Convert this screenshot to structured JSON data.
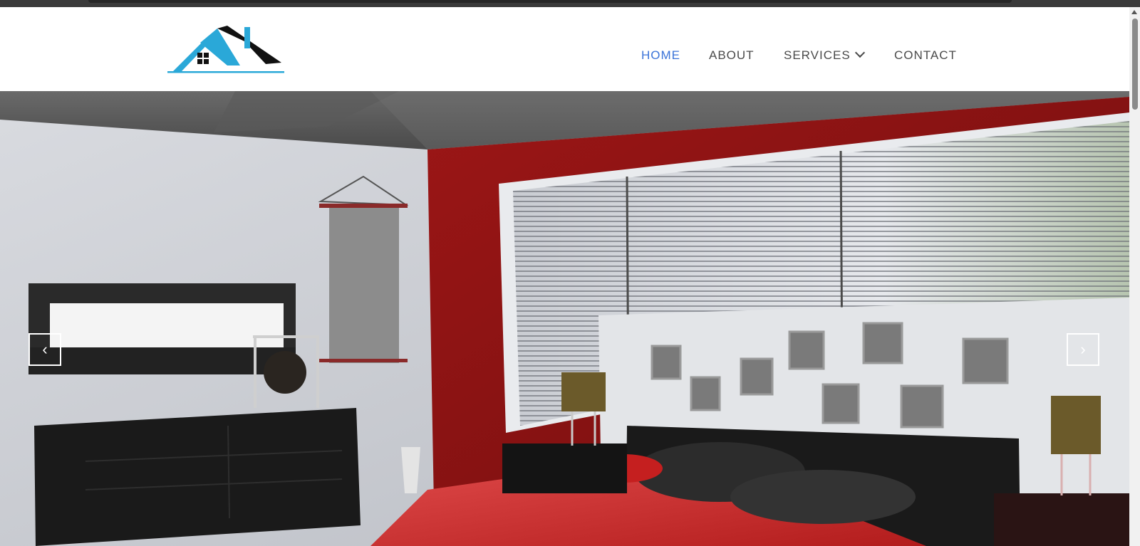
{
  "nav": {
    "items": [
      {
        "label": "HOME",
        "active": true
      },
      {
        "label": "ABOUT",
        "active": false
      },
      {
        "label": "SERVICES",
        "active": false,
        "has_dropdown": true
      },
      {
        "label": "CONTACT",
        "active": false
      }
    ]
  },
  "carousel": {
    "prev_label": "‹",
    "next_label": "›"
  },
  "colors": {
    "accent": "#3a73d8",
    "logo_blue": "#2aa8d8",
    "wall_red": "#8e1313"
  },
  "icons": {
    "dropdown": "chevron-down-icon",
    "prev": "chevron-left-icon",
    "next": "chevron-right-icon"
  }
}
